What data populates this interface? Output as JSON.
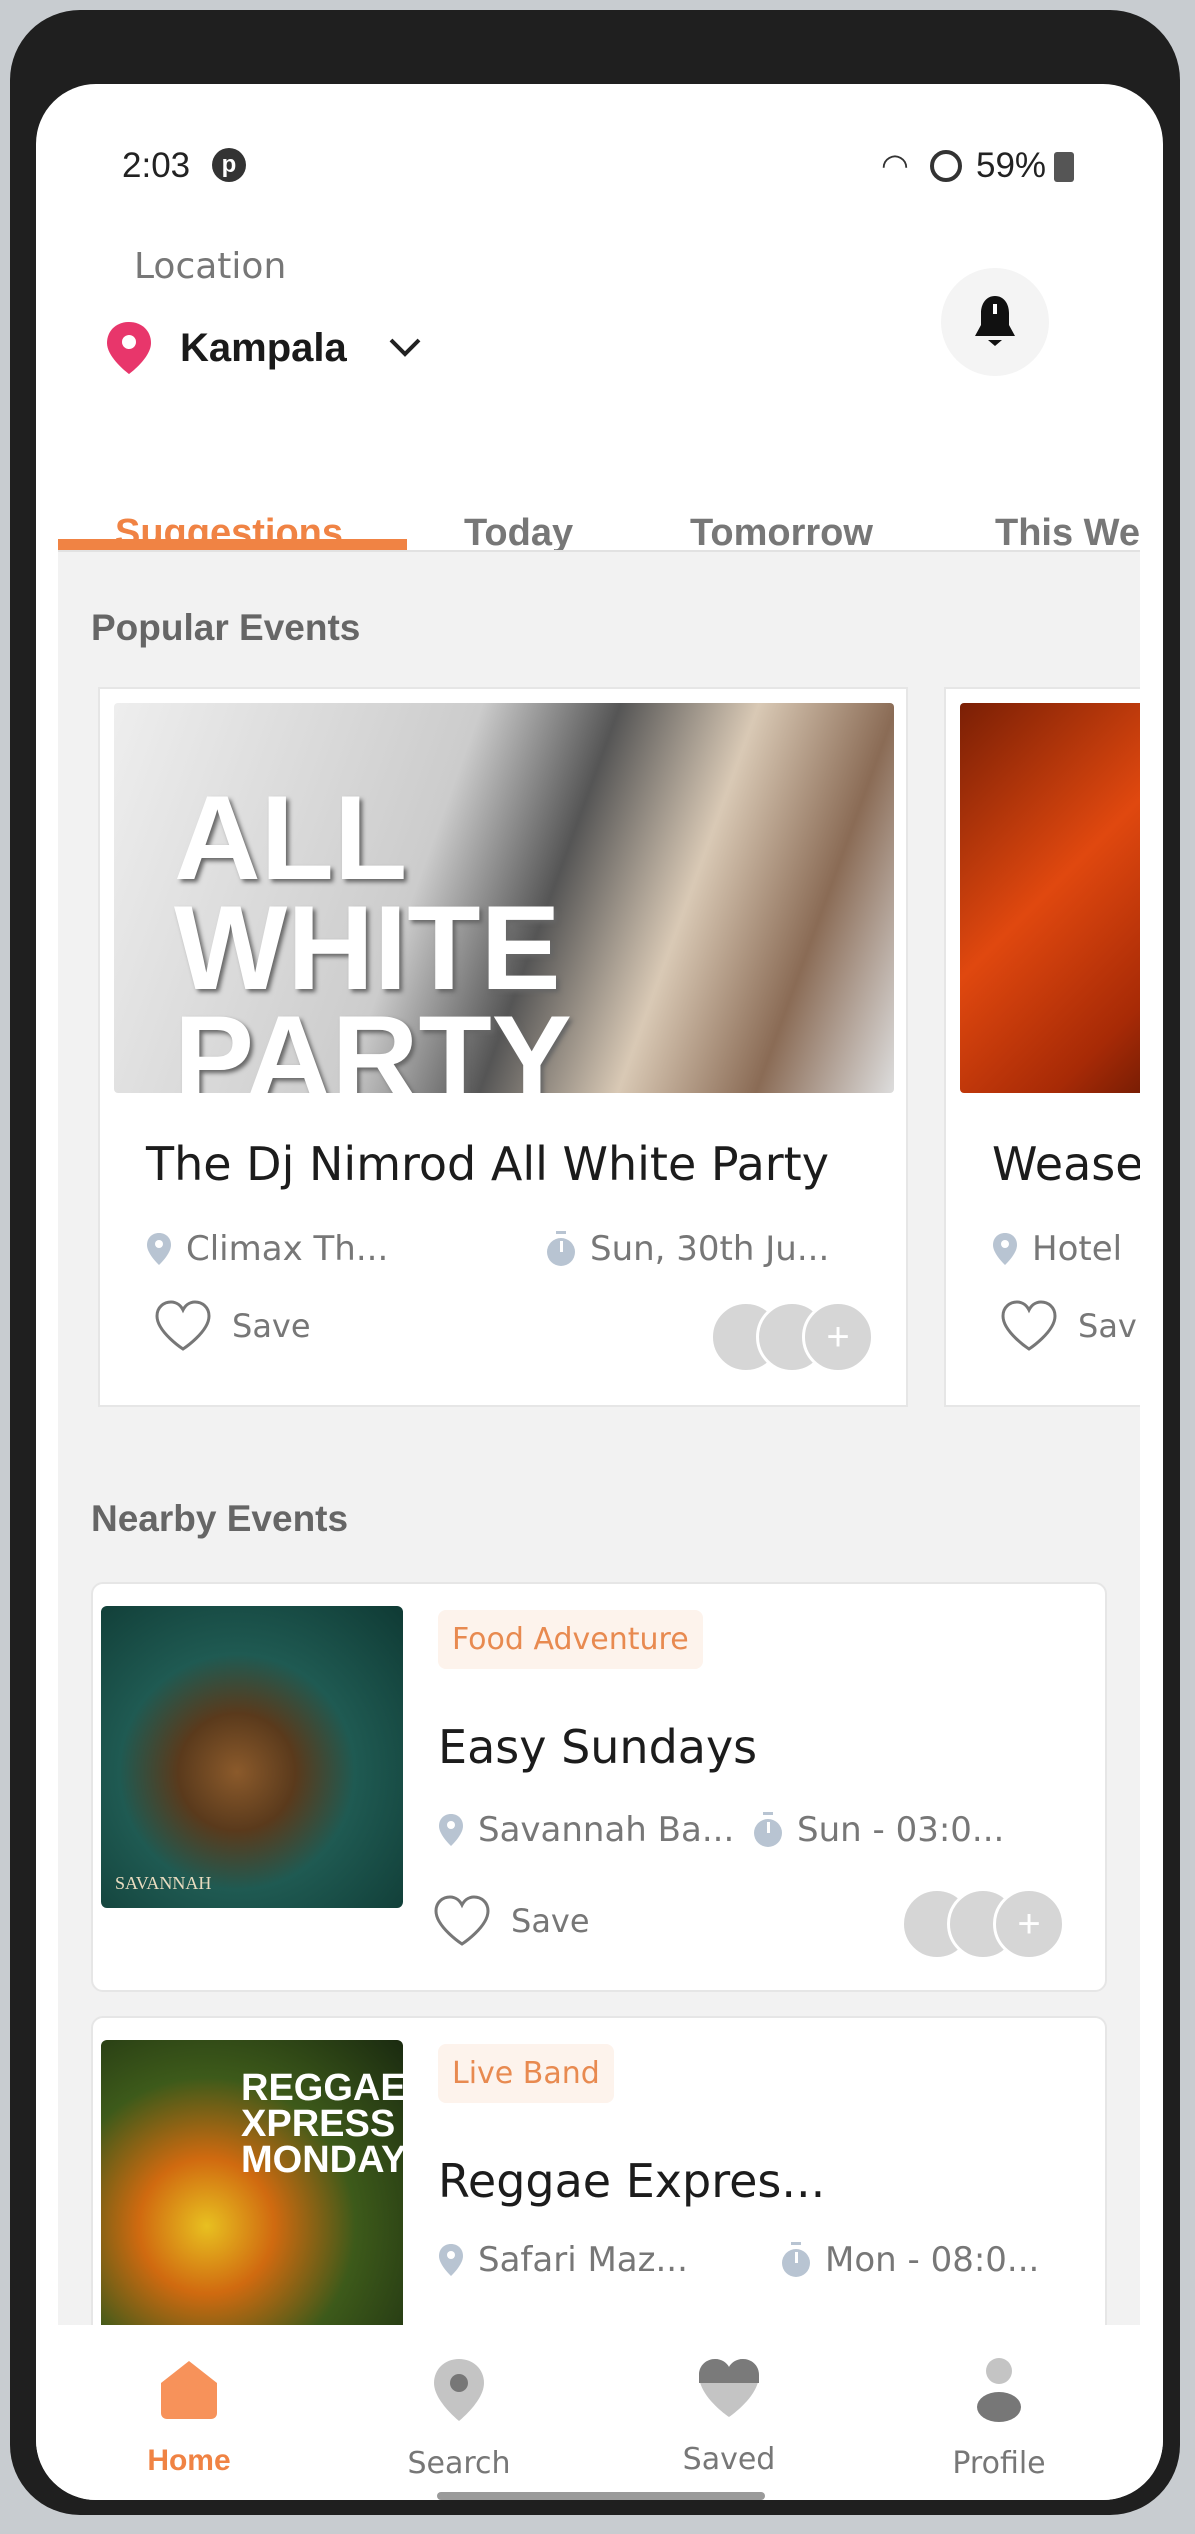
{
  "status_bar": {
    "time": "2:03",
    "battery": "59%"
  },
  "header": {
    "location_label": "Location",
    "city": "Kampala"
  },
  "tabs": [
    {
      "label": "Suggestions",
      "active": true
    },
    {
      "label": "Today"
    },
    {
      "label": "Tomorrow"
    },
    {
      "label": "This We"
    }
  ],
  "popular": {
    "title": "Popular Events",
    "events": [
      {
        "title": "The Dj Nimrod All White Party",
        "venue": "Climax Th...",
        "date": "Sun, 30th Ju...",
        "save": "Save",
        "poster_text": "ALL WHITE PARTY"
      },
      {
        "title": "Wease",
        "venue": "Hotel",
        "save": "Sav"
      }
    ]
  },
  "nearby": {
    "title": "Nearby Events",
    "events": [
      {
        "tag": "Food Adventure",
        "title": "Easy Sundays",
        "venue": "Savannah Ba...",
        "date": "Sun - 03:0...",
        "save": "Save",
        "poster_text": "SAVANNAH"
      },
      {
        "tag": "Live Band",
        "title": "Reggae Expres...",
        "venue": "Safari Maz...",
        "date": "Mon - 08:0...",
        "poster_text": "REGGAE XPRESS MONDAY"
      }
    ]
  },
  "nav": [
    {
      "label": "Home",
      "icon": "home-icon",
      "active": true
    },
    {
      "label": "Search",
      "icon": "map-pin-icon"
    },
    {
      "label": "Saved",
      "icon": "heart-icon"
    },
    {
      "label": "Profile",
      "icon": "person-icon"
    }
  ],
  "colors": {
    "accent": "#f08344",
    "pin": "#e8366b",
    "content_bg": "#f2f2f2"
  }
}
